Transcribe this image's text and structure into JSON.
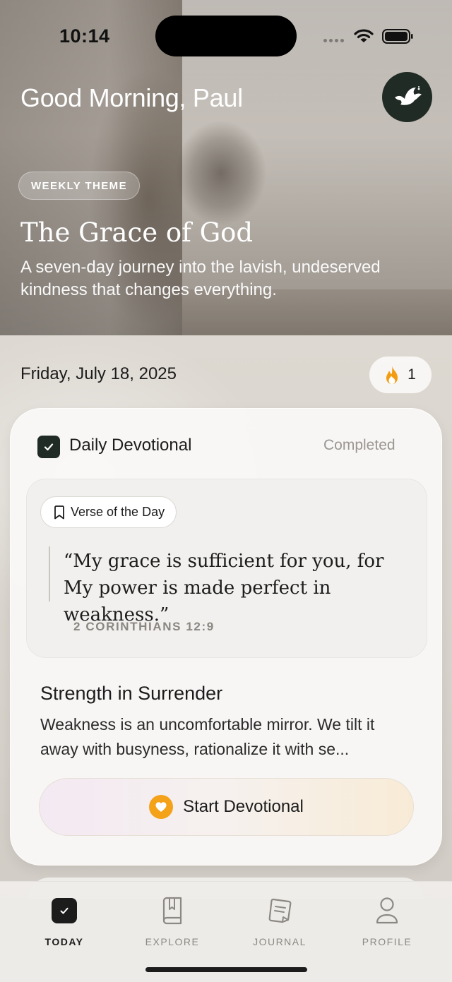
{
  "status_bar": {
    "time": "10:14"
  },
  "header": {
    "greeting": "Good Morning, Paul",
    "avatar_icon": "dove-icon"
  },
  "weekly_theme": {
    "badge": "WEEKLY THEME",
    "title": "The Grace of God",
    "description": "A seven-day journey into the lavish, undeserved kindness that changes everything."
  },
  "date_row": {
    "date": "Friday, July 18, 2025",
    "streak_count": "1",
    "streak_icon": "flame-icon"
  },
  "devotional_card": {
    "title": "Daily Devotional",
    "status": "Completed",
    "verse_badge": "Verse of the Day",
    "verse_text": "“My grace is sufficient for you, for My power is made perfect in weakness.”",
    "verse_reference": "2 CORINTHIANS 12:9",
    "devotional_title": "Strength in Surrender",
    "devotional_excerpt": "Weakness is an uncomfortable mirror. We tilt it away with busyness, rationalize it with se...",
    "start_button": "Start Devotional"
  },
  "tabs": [
    {
      "label": "TODAY",
      "icon": "checkbox-icon",
      "active": true
    },
    {
      "label": "EXPLORE",
      "icon": "book-icon",
      "active": false
    },
    {
      "label": "JOURNAL",
      "icon": "journal-icon",
      "active": false
    },
    {
      "label": "PROFILE",
      "icon": "person-icon",
      "active": false
    }
  ],
  "colors": {
    "accent_dark": "#1f2b24",
    "flame": "#f3a21a",
    "muted": "#9a9690"
  }
}
